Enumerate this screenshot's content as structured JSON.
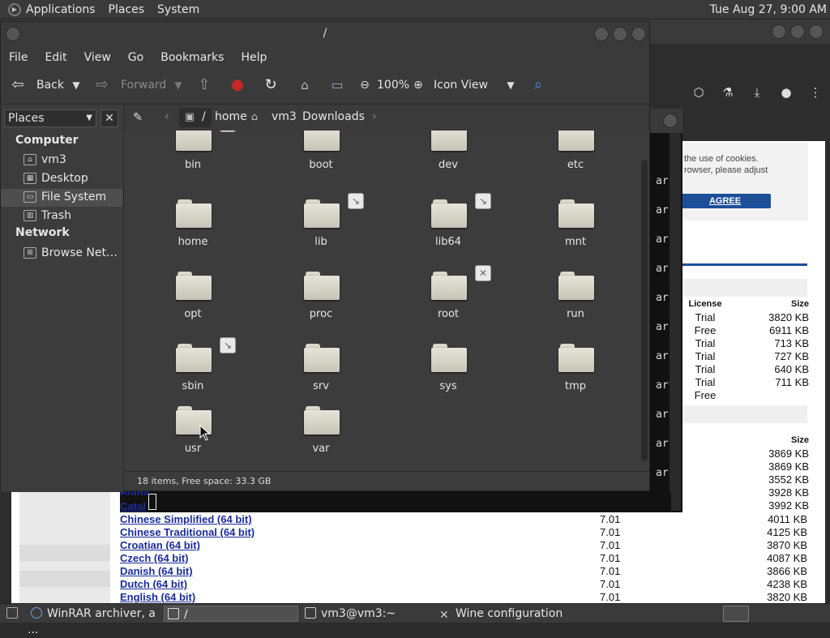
{
  "top_panel": {
    "menus": [
      "Applications",
      "Places",
      "System"
    ],
    "clock": "Tue Aug 27,  9:00 AM"
  },
  "browser": {
    "cookie_text_1": "the use of cookies.",
    "cookie_text_2": "rowser, please adjust",
    "agree_label": "AGREE",
    "table1_header": {
      "license": "License",
      "size": "Size"
    },
    "table1_rows": [
      {
        "license": "Trial",
        "size": "3820 KB"
      },
      {
        "license": "Free",
        "size": "6911 KB"
      },
      {
        "license": "Trial",
        "size": "713 KB"
      },
      {
        "license": "Trial",
        "size": "727 KB"
      },
      {
        "license": "Trial",
        "size": "640 KB"
      },
      {
        "license": "Trial",
        "size": "711 KB"
      },
      {
        "license": "Free",
        "size": ""
      }
    ],
    "table2_header": {
      "size": "Size"
    },
    "table2_sizes": [
      "3869 KB",
      "3869 KB",
      "3552 KB",
      "3928 KB",
      "3992 KB"
    ],
    "lang_partials": [
      "Bulga",
      "Catal"
    ],
    "lang_rows": [
      {
        "name": "Chinese Simplified (64 bit)",
        "version": "7.01",
        "size": "4011 KB"
      },
      {
        "name": "Chinese Traditional (64 bit)",
        "version": "7.01",
        "size": "4125 KB"
      },
      {
        "name": "Croatian (64 bit)",
        "version": "7.01",
        "size": "3870 KB"
      },
      {
        "name": "Czech (64 bit)",
        "version": "7.01",
        "size": "4087 KB"
      },
      {
        "name": "Danish (64 bit)",
        "version": "7.01",
        "size": "3866 KB"
      },
      {
        "name": "Dutch (64 bit)",
        "version": "7.01",
        "size": "4238 KB"
      },
      {
        "name": "English (64 bit)",
        "version": "7.01",
        "size": "3820 KB"
      }
    ]
  },
  "terminal": {
    "lines": [
      "ar",
      "ar",
      "ar",
      "ar",
      "ar",
      "ar",
      "ar",
      "ar",
      "ar",
      "ar",
      "ar"
    ]
  },
  "file_manager": {
    "title": "/",
    "menu": [
      "File",
      "Edit",
      "View",
      "Go",
      "Bookmarks",
      "Help"
    ],
    "toolbar": {
      "back": "Back",
      "forward": "Forward",
      "zoom": "100%",
      "view_mode": "Icon View"
    },
    "path": {
      "root": "/",
      "items": [
        "home",
        "vm3",
        "Downloads"
      ]
    },
    "sidebar": {
      "title": "Places",
      "sections": [
        {
          "heading": "Computer",
          "items": [
            "vm3",
            "Desktop",
            "File System",
            "Trash"
          ]
        },
        {
          "heading": "Network",
          "items": [
            "Browse Net…"
          ]
        }
      ],
      "selected": "File System"
    },
    "folders": [
      "bin",
      "boot",
      "dev",
      "etc",
      "home",
      "lib",
      "lib64",
      "mnt",
      "opt",
      "proc",
      "root",
      "run",
      "sbin",
      "srv",
      "sys",
      "tmp",
      "usr",
      "var"
    ],
    "status": "18 items, Free space: 33.3 GB"
  },
  "taskbar": {
    "tasks": [
      "WinRAR archiver, a ...",
      "/",
      "vm3@vm3:~",
      "Wine configuration"
    ]
  },
  "colors": {
    "accent_link": "#1a2c9c",
    "agree_button": "#1d4f98"
  }
}
